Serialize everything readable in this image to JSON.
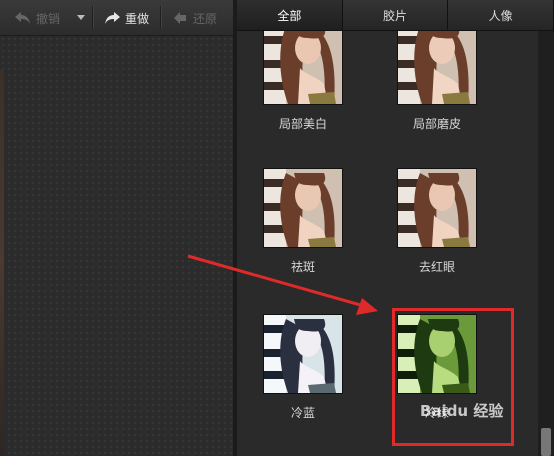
{
  "toolbar": {
    "undo_label": "撤销",
    "redo_label": "重做",
    "restore_label": "还原"
  },
  "tabs": [
    {
      "label": "全部",
      "selected": true
    },
    {
      "label": "胶片",
      "selected": false
    },
    {
      "label": "人像",
      "selected": false
    }
  ],
  "effects": [
    {
      "label": "局部美白",
      "tint": "normal"
    },
    {
      "label": "局部磨皮",
      "tint": "normal"
    },
    {
      "label": "祛斑",
      "tint": "normal"
    },
    {
      "label": "去红眼",
      "tint": "normal"
    },
    {
      "label": "冷蓝",
      "tint": "cold-blue"
    },
    {
      "label": "冷绿",
      "tint": "cold-green"
    }
  ],
  "watermark": "Baidu 经验",
  "colors": {
    "highlight": "#e02a2a",
    "arrow": "#e02a2a"
  }
}
